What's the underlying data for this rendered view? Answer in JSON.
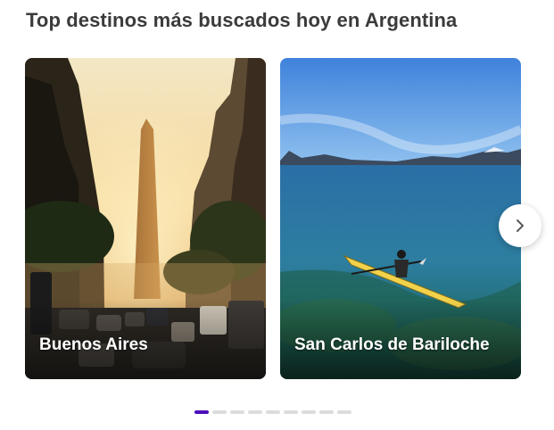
{
  "section": {
    "title": "Top destinos más buscados hoy en Argentina"
  },
  "cards": [
    {
      "label": "Buenos Aires",
      "image": "obelisco-street-sunset"
    },
    {
      "label": "San Carlos de Bariloche",
      "image": "kayak-lake-mountains"
    }
  ],
  "carousel": {
    "next_icon": "chevron-right-icon",
    "page_count": 9,
    "active_page": 1
  },
  "colors": {
    "title": "#3b3b3b",
    "active_dot": "#4b0fb8",
    "inactive_dot": "#dcdcdc"
  }
}
